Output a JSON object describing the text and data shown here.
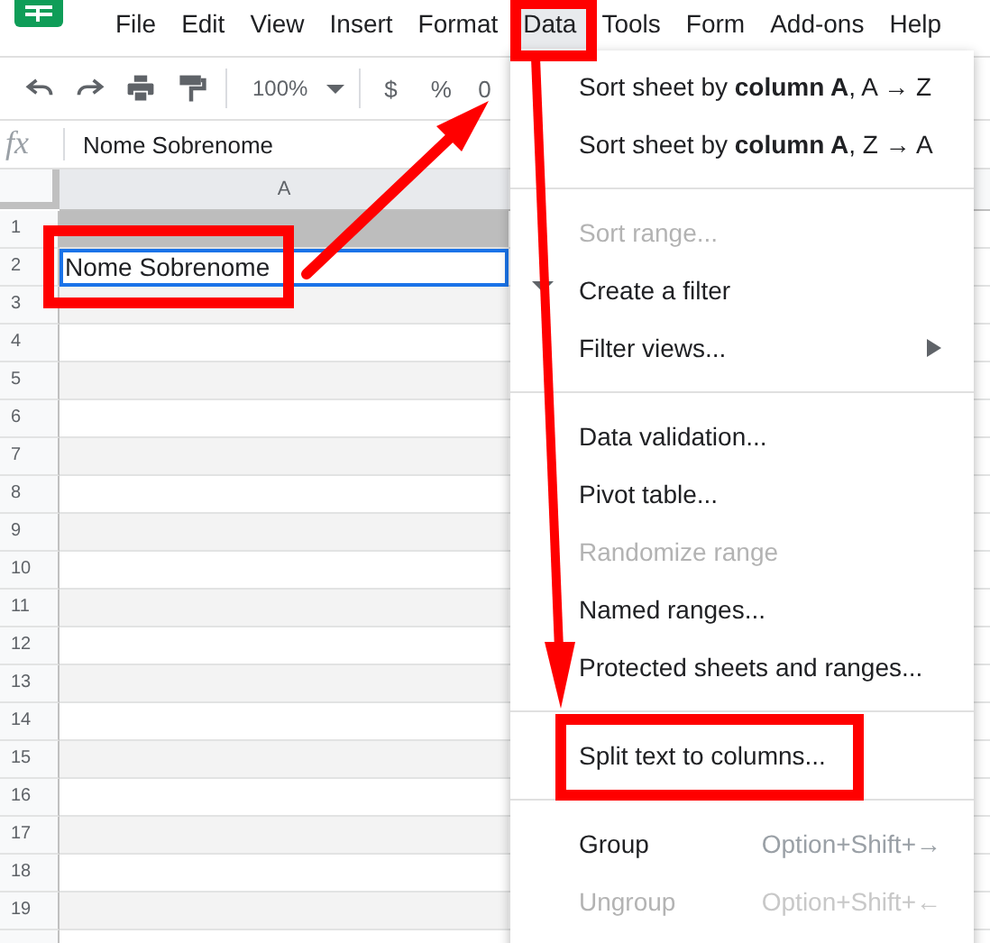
{
  "menubar": [
    {
      "label": "File",
      "selected": false
    },
    {
      "label": "Edit",
      "selected": false
    },
    {
      "label": "View",
      "selected": false
    },
    {
      "label": "Insert",
      "selected": false
    },
    {
      "label": "Format",
      "selected": false
    },
    {
      "label": "Data",
      "selected": true
    },
    {
      "label": "Tools",
      "selected": false
    },
    {
      "label": "Form",
      "selected": false
    },
    {
      "label": "Add-ons",
      "selected": false
    },
    {
      "label": "Help",
      "selected": false
    }
  ],
  "toolbar": {
    "zoom": "100%",
    "currency": "$",
    "percent": "%",
    "decimals": "0"
  },
  "formula_bar": {
    "label": "fx",
    "value": "Nome Sobrenome"
  },
  "sheet": {
    "columns": [
      "A"
    ],
    "rows": [
      {
        "number": "1",
        "kind": "band",
        "value": "",
        "selected": false
      },
      {
        "number": "2",
        "kind": "plain",
        "value": "Nome Sobrenome",
        "selected": true
      },
      {
        "number": "3",
        "kind": "plain",
        "value": "",
        "selected": false
      },
      {
        "number": "4",
        "kind": "plain",
        "value": "",
        "selected": false
      },
      {
        "number": "5",
        "kind": "plain",
        "value": "",
        "selected": false
      },
      {
        "number": "6",
        "kind": "plain",
        "value": "",
        "selected": false
      },
      {
        "number": "7",
        "kind": "plain",
        "value": "",
        "selected": false
      },
      {
        "number": "8",
        "kind": "plain",
        "value": "",
        "selected": false
      },
      {
        "number": "9",
        "kind": "plain",
        "value": "",
        "selected": false
      },
      {
        "number": "10",
        "kind": "plain",
        "value": "",
        "selected": false
      },
      {
        "number": "11",
        "kind": "plain",
        "value": "",
        "selected": false
      },
      {
        "number": "12",
        "kind": "plain",
        "value": "",
        "selected": false
      },
      {
        "number": "13",
        "kind": "plain",
        "value": "",
        "selected": false
      },
      {
        "number": "14",
        "kind": "plain",
        "value": "",
        "selected": false
      },
      {
        "number": "15",
        "kind": "plain",
        "value": "",
        "selected": false
      },
      {
        "number": "16",
        "kind": "plain",
        "value": "",
        "selected": false
      },
      {
        "number": "17",
        "kind": "plain",
        "value": "",
        "selected": false
      },
      {
        "number": "18",
        "kind": "plain",
        "value": "",
        "selected": false
      },
      {
        "number": "19",
        "kind": "plain",
        "value": "",
        "selected": false
      }
    ]
  },
  "data_menu": [
    {
      "kind": "item",
      "label": "Sort sheet by **column A**, A → Z",
      "disabled": false
    },
    {
      "kind": "item",
      "label": "Sort sheet by **column A**, Z → A",
      "disabled": false
    },
    {
      "kind": "separator"
    },
    {
      "kind": "item",
      "label": "Sort range...",
      "disabled": true
    },
    {
      "kind": "filter",
      "label": "Create a filter",
      "disabled": false
    },
    {
      "kind": "item",
      "label": "Filter views...",
      "disabled": false,
      "submenu": true
    },
    {
      "kind": "separator"
    },
    {
      "kind": "item",
      "label": "Data validation...",
      "disabled": false
    },
    {
      "kind": "item",
      "label": "Pivot table...",
      "disabled": false
    },
    {
      "kind": "item",
      "label": "Randomize range",
      "disabled": true
    },
    {
      "kind": "item",
      "label": "Named ranges...",
      "disabled": false
    },
    {
      "kind": "item",
      "label": "Protected sheets and ranges...",
      "disabled": false
    },
    {
      "kind": "separator"
    },
    {
      "kind": "item",
      "label": "Split text to columns...",
      "disabled": false
    },
    {
      "kind": "separator"
    },
    {
      "kind": "item",
      "label": "Group",
      "disabled": false,
      "shortcut": "Option+Shift+→"
    },
    {
      "kind": "item",
      "label": "Ungroup",
      "disabled": true,
      "shortcut": "Option+Shift+←"
    }
  ]
}
